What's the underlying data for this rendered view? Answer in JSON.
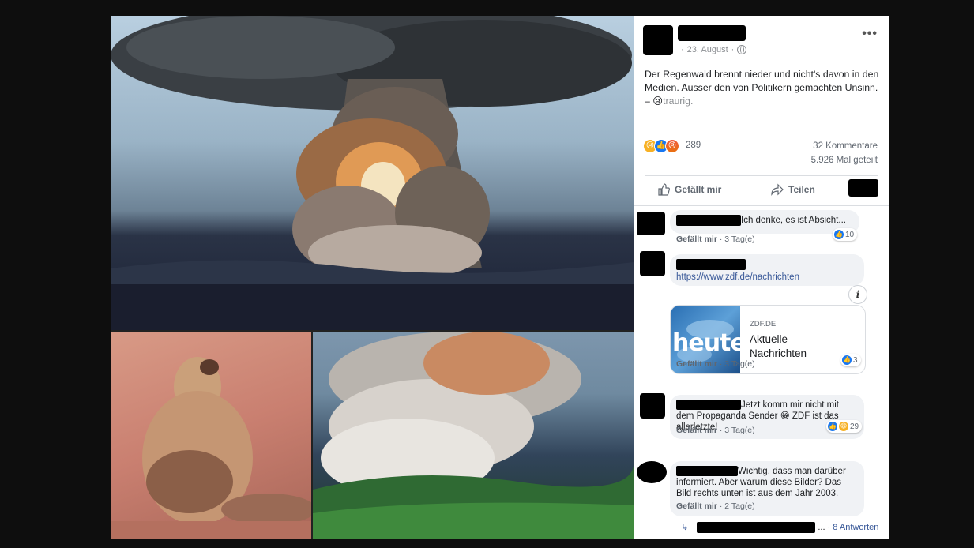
{
  "post": {
    "date": "23. August",
    "text": "Der Regenwald brennt nieder und nicht's davon in den Medien. Ausser den von Politikern gemachten Unsinn.",
    "feeling_prefix": " – ",
    "feeling_emoji": "😢",
    "feeling": "traurig.",
    "more": "•••",
    "reaction_count": "289",
    "comments_count": "32 Kommentare",
    "shares_count": "5.926 Mal geteilt",
    "like_label": "Gefällt mir",
    "share_label": "Teilen"
  },
  "comments": [
    {
      "text": "Ich denke, es ist Absicht...",
      "like_label": "Gefällt mir",
      "time": "3 Tag(e)",
      "reactions": "10"
    },
    {
      "link": "https://www.zdf.de/nachrichten",
      "card_domain": "ZDF.DE",
      "card_title": "Aktuelle Nachrichten",
      "thumb_text": "heute",
      "like_label": "Gefällt mir",
      "time": "3 Tag(e)",
      "reactions": "3"
    },
    {
      "text": "Jetzt komm mir nicht mit dem Propaganda Sender 😁 ZDF ist das allerletzte!",
      "like_label": "Gefällt mir",
      "time": "3 Tag(e)",
      "reactions": "29"
    },
    {
      "text": "Wichtig, dass man darüber informiert. Aber warum diese Bilder? Das Bild rechts unten ist aus dem Jahr 2003.",
      "like_label": "Gefällt mir",
      "time": "2 Tag(e)",
      "reply_count": "8 Antworten",
      "reply_ellipsis": "..."
    }
  ],
  "colors": {
    "accent": "#1877f2",
    "link": "#385898",
    "bubble": "#f0f2f5"
  }
}
